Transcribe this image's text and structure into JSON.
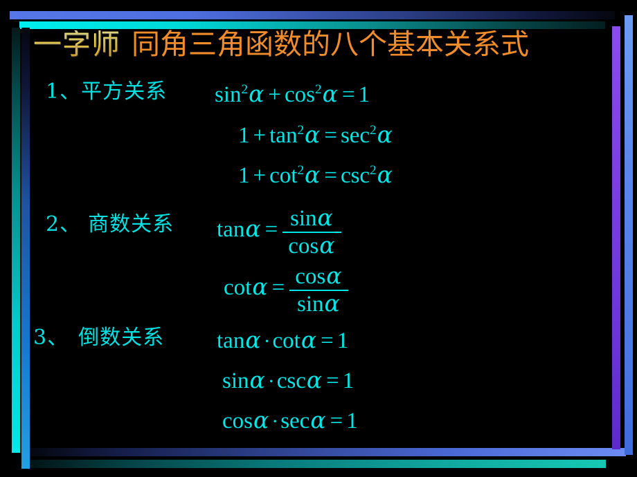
{
  "slide": {
    "background_color": "#000000",
    "title": {
      "prefix": "一字师",
      "prefix_color": "#FFD93B",
      "main": "同角三角函数的八个基本关系式",
      "main_color": "#F08C2C"
    },
    "text_color": "#00E5E5",
    "border": {
      "top_blue_color": "#4E6FE0",
      "top_cyan_color": "#00D8D8",
      "left_cyan_color": "#00CCCC",
      "left_blue_color": "#1878CC",
      "bottom_blue_color": "#6C8CF4",
      "bottom_teal_color": "#10A8A0",
      "right_purple_color": "#7B3FE4",
      "right_blue_color": "#5A86EC"
    },
    "groups": [
      {
        "index": "1、",
        "label": "平方关系",
        "equations": [
          {
            "id": "eq-sin2-plus-cos2",
            "plain": "sin² α + cos² α = 1",
            "parts": [
              {
                "t": "sin",
                "sup": "2"
              },
              {
                "t": "α",
                "italic": true
              },
              {
                "t": "+",
                "op": true
              },
              {
                "t": "cos",
                "sup": "2"
              },
              {
                "t": "α",
                "italic": true
              },
              {
                "t": "=",
                "op": true
              },
              {
                "t": "1"
              }
            ]
          },
          {
            "id": "eq-1-plus-tan2",
            "plain": "1 + tan² α = sec² α",
            "parts": [
              {
                "t": "1"
              },
              {
                "t": "+",
                "op": true
              },
              {
                "t": "tan",
                "sup": "2"
              },
              {
                "t": "α",
                "italic": true
              },
              {
                "t": "=",
                "op": true
              },
              {
                "t": "sec",
                "sup": "2"
              },
              {
                "t": "α",
                "italic": true
              }
            ]
          },
          {
            "id": "eq-1-plus-cot2",
            "plain": "1 + cot² α = csc² α",
            "parts": [
              {
                "t": "1"
              },
              {
                "t": "+",
                "op": true
              },
              {
                "t": "cot",
                "sup": "2"
              },
              {
                "t": "α",
                "italic": true
              },
              {
                "t": "=",
                "op": true
              },
              {
                "t": "csc",
                "sup": "2"
              },
              {
                "t": "α",
                "italic": true
              }
            ]
          }
        ]
      },
      {
        "index": "2、",
        "label": "商数关系",
        "equations": [
          {
            "id": "eq-tan-frac",
            "plain": "tan α = sin α / cos α",
            "lhs": "tan",
            "numerator": "sin α",
            "denominator": "cos α"
          },
          {
            "id": "eq-cot-frac",
            "plain": "cot α = cos α / sin α",
            "lhs": "cot",
            "numerator": "cos α",
            "denominator": "sin α"
          }
        ]
      },
      {
        "index": "3、",
        "label": "倒数关系",
        "equations": [
          {
            "id": "eq-tan-cot",
            "plain": "tan α · cot α = 1",
            "parts": [
              {
                "t": "tan"
              },
              {
                "t": "α",
                "italic": true
              },
              {
                "t": "·",
                "dot": true
              },
              {
                "t": "cot"
              },
              {
                "t": "α",
                "italic": true
              },
              {
                "t": "=",
                "op": true
              },
              {
                "t": "1"
              }
            ]
          },
          {
            "id": "eq-sin-csc",
            "plain": "sin α · csc α = 1",
            "parts": [
              {
                "t": "sin"
              },
              {
                "t": "α",
                "italic": true
              },
              {
                "t": "·",
                "dot": true
              },
              {
                "t": "csc"
              },
              {
                "t": "α",
                "italic": true
              },
              {
                "t": "=",
                "op": true
              },
              {
                "t": "1"
              }
            ]
          },
          {
            "id": "eq-cos-sec",
            "plain": "cos α · sec α = 1",
            "parts": [
              {
                "t": "cos"
              },
              {
                "t": "α",
                "italic": true
              },
              {
                "t": "·",
                "dot": true
              },
              {
                "t": "sec"
              },
              {
                "t": "α",
                "italic": true
              },
              {
                "t": "=",
                "op": true
              },
              {
                "t": "1"
              }
            ]
          }
        ]
      }
    ]
  }
}
